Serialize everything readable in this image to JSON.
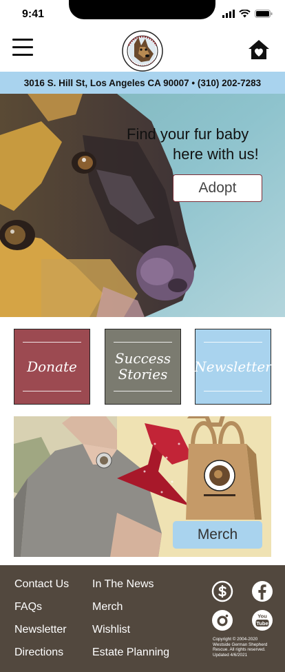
{
  "status_bar": {
    "time": "9:41"
  },
  "header": {
    "menu_icon": "hamburger-menu-icon",
    "logo_icon": "westside-german-shepherd-rescue-logo",
    "home_icon": "home-heart-icon"
  },
  "address_bar": {
    "text": "3016 S. Hill St, Los Angeles CA 90007 •  (310) 202-7283"
  },
  "hero": {
    "line1": "Find your fur baby",
    "line2": "here with us!",
    "adopt_label": "Adopt"
  },
  "tiles": [
    {
      "line1": "Donate",
      "line2": "",
      "color": "#9c4a51"
    },
    {
      "line1": "Success",
      "line2": "Stories",
      "color": "#7b7b70"
    },
    {
      "line1": "Newsletter",
      "line2": "",
      "color": "#a9d3ee"
    }
  ],
  "merch": {
    "button_label": "Merch"
  },
  "footer": {
    "col1": [
      "Contact Us",
      "FAQs",
      "Newsletter",
      "Directions"
    ],
    "col2": [
      "In The News",
      "Merch",
      "Wishlist",
      "Estate Planning"
    ],
    "social_icons": [
      "dollar-icon",
      "facebook-icon",
      "instagram-icon",
      "youtube-icon"
    ],
    "copyright": [
      "Copyright © 2004-2020",
      "Westside German Shepherd",
      "Rescue. All rights reserved.",
      "Updated 4/6/2021"
    ]
  },
  "colors": {
    "accent_blue": "#a9d3ee",
    "donate_red": "#9c4a51",
    "success_gray": "#7b7b70",
    "footer_brown": "#52483e"
  }
}
